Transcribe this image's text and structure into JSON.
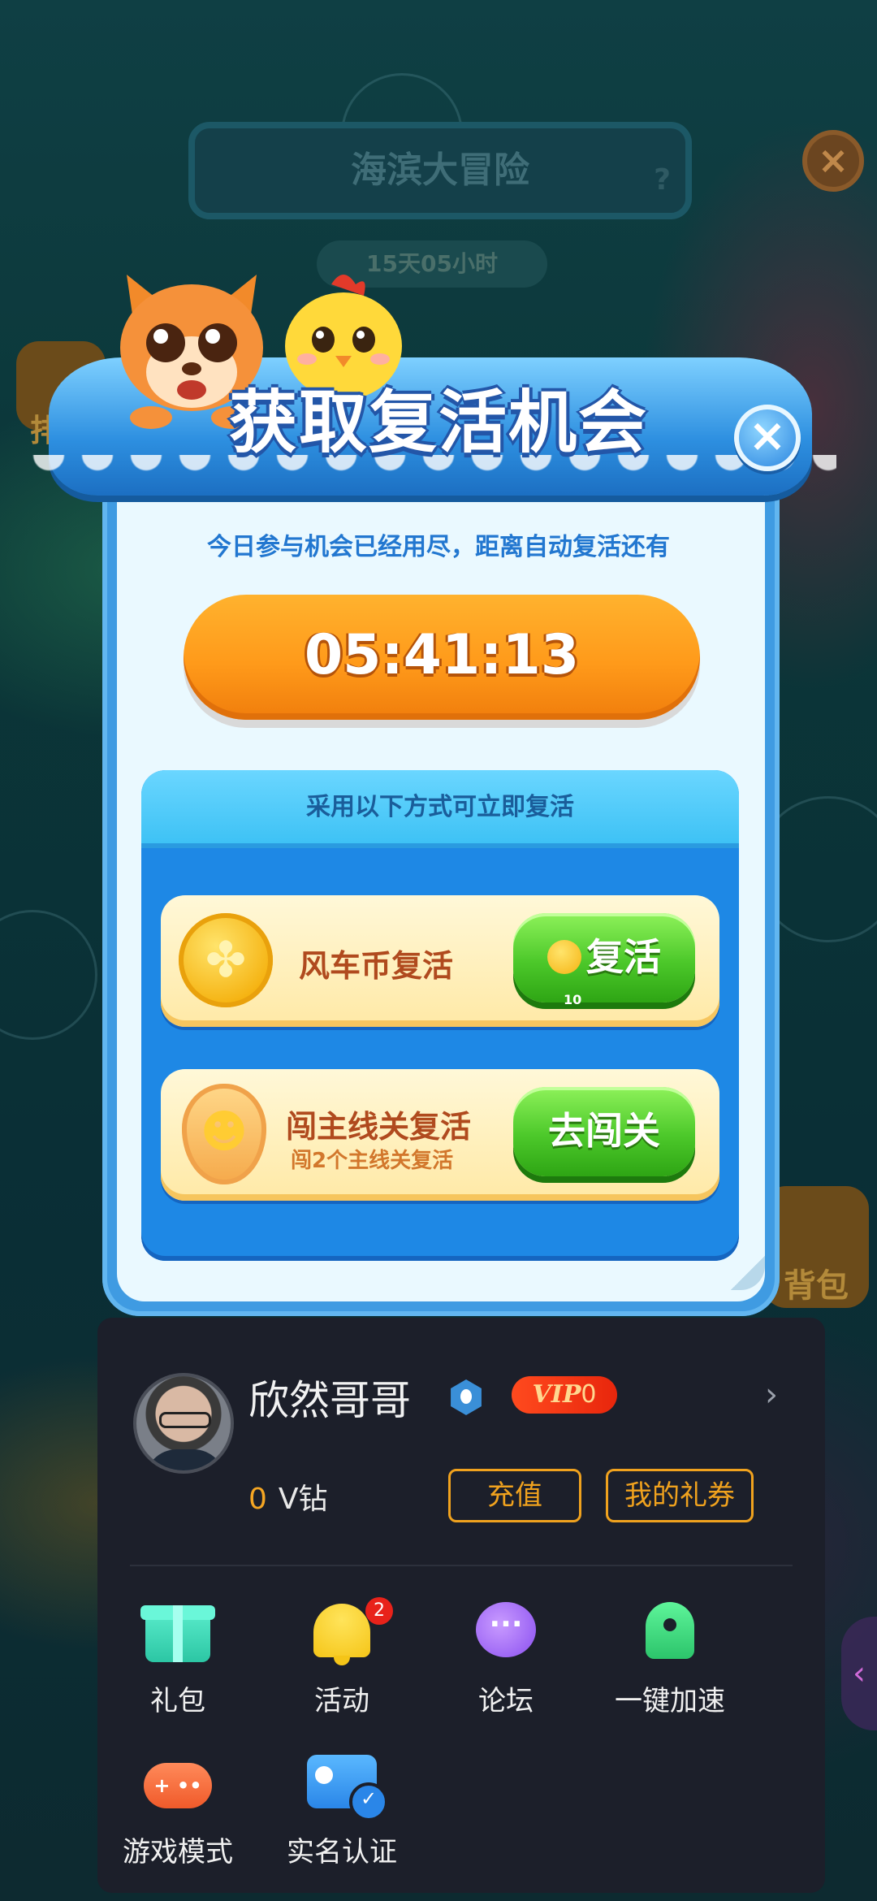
{
  "background": {
    "event_title": "海滨大冒险",
    "event_help": "?",
    "event_timer": "15天05小时",
    "rank_label": "排行",
    "bag_label": "背包",
    "close_glyph": "×"
  },
  "dialog": {
    "title": "获取复活机会",
    "close_glyph": "×",
    "subtitle": "今日参与机会已经用尽，距离自动复活还有",
    "countdown": "05:41:13",
    "methods_header": "采用以下方式可立即复活",
    "methods": [
      {
        "title": "风车币复活",
        "subtitle": "",
        "button_label": "复活",
        "button_cost": "10",
        "icon": "windmill-coin-icon"
      },
      {
        "title": "闯主线关复活",
        "subtitle": "闯2个主线关复活",
        "button_label": "去闯关",
        "icon": "level-badge-icon"
      }
    ]
  },
  "user_sheet": {
    "username": "欣然哥哥",
    "vip_label": "VIP",
    "vip_level": "0",
    "chevron": "›",
    "balance_value": "0",
    "balance_unit": "V钻",
    "recharge_label": "充值",
    "coupon_label": "我的礼券",
    "grid": [
      {
        "label": "礼包",
        "icon": "gift-icon"
      },
      {
        "label": "活动",
        "icon": "bell-icon",
        "badge": "2"
      },
      {
        "label": "论坛",
        "icon": "forum-icon"
      },
      {
        "label": "一键加速",
        "icon": "rocket-icon"
      },
      {
        "label": "游戏模式",
        "icon": "gamepad-icon"
      },
      {
        "label": "实名认证",
        "icon": "id-card-icon"
      }
    ],
    "side_handle_glyph": "‹"
  },
  "colors": {
    "accent_orange": "#f0a21e",
    "sheet_bg": "#1c1f2a",
    "dialog_blue": "#3f9be2",
    "button_green": "#4cc82a",
    "countdown_orange": "#ff9a1a",
    "badge_red": "#e8221a"
  }
}
